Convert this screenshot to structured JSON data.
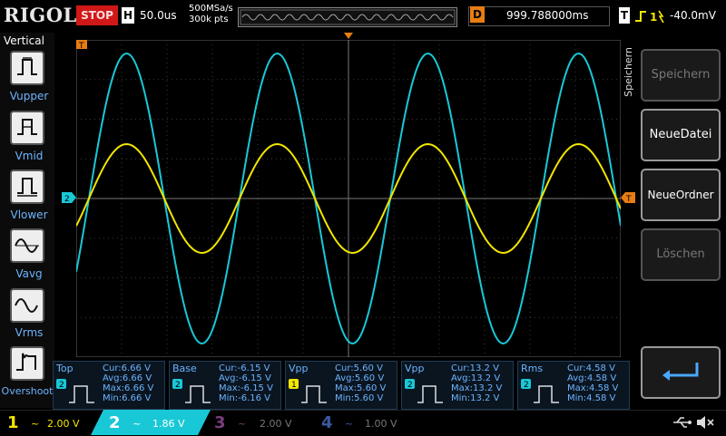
{
  "header": {
    "brand": "RIGOL",
    "run_status": "STOP",
    "timebase_label": "H",
    "timebase_value": "50.0us",
    "sample_rate": "500MSa/s",
    "memory_depth": "300k pts",
    "delay_label": "D",
    "delay_value": "999.788000ms",
    "trigger_label": "T",
    "trigger_level": "-40.0mV"
  },
  "left_menu": {
    "title": "Vertical",
    "items": [
      "Vupper",
      "Vmid",
      "Vlower",
      "Vavg",
      "Vrms",
      "Overshoot"
    ]
  },
  "right_menu": {
    "side_title": "Speichern",
    "items": [
      {
        "label": "Speichern",
        "enabled": false
      },
      {
        "label": "NeueDatei",
        "enabled": true
      },
      {
        "label": "NeueOrdner",
        "enabled": true
      },
      {
        "label": "Löschen",
        "enabled": false
      }
    ]
  },
  "measurements": [
    {
      "name": "Top",
      "channel": "2",
      "cur": "Cur:6.66 V",
      "avg": "Avg:6.66 V",
      "max": "Max:6.66 V",
      "min": "Min:6.66 V"
    },
    {
      "name": "Base",
      "channel": "2",
      "cur": "Cur:-6.15 V",
      "avg": "Avg:-6.15 V",
      "max": "Max:-6.15 V",
      "min": "Min:-6.16 V"
    },
    {
      "name": "Vpp",
      "channel": "1",
      "cur": "Cur:5.60 V",
      "avg": "Avg:5.60 V",
      "max": "Max:5.60 V",
      "min": "Min:5.60 V"
    },
    {
      "name": "Vpp",
      "channel": "2",
      "cur": "Cur:13.2 V",
      "avg": "Avg:13.2 V",
      "max": "Max:13.2 V",
      "min": "Min:13.2 V"
    },
    {
      "name": "Rms",
      "channel": "2",
      "cur": "Cur:4.58 V",
      "avg": "Avg:4.58 V",
      "max": "Max:4.58 V",
      "min": "Min:4.58 V"
    }
  ],
  "channels": [
    {
      "num": "1",
      "coupling": "~",
      "scale": "2.00 V",
      "color": "#f2e600",
      "active": false
    },
    {
      "num": "2",
      "coupling": "~",
      "scale": "1.86 V",
      "color": "#19c8d6",
      "active": true
    },
    {
      "num": "3",
      "coupling": "~",
      "scale": "2.00 V",
      "color": "#7a3d7a",
      "active": false
    },
    {
      "num": "4",
      "coupling": "~",
      "scale": "1.00 V",
      "color": "#3a5aa0",
      "active": false
    }
  ],
  "colors": {
    "ch1": "#f2e600",
    "ch2": "#19c8d6",
    "trigger": "#e87d12",
    "menu_text": "#6db4ff"
  },
  "icons": [
    "usb-icon",
    "speaker-mute-icon",
    "return-arrow-icon"
  ]
}
